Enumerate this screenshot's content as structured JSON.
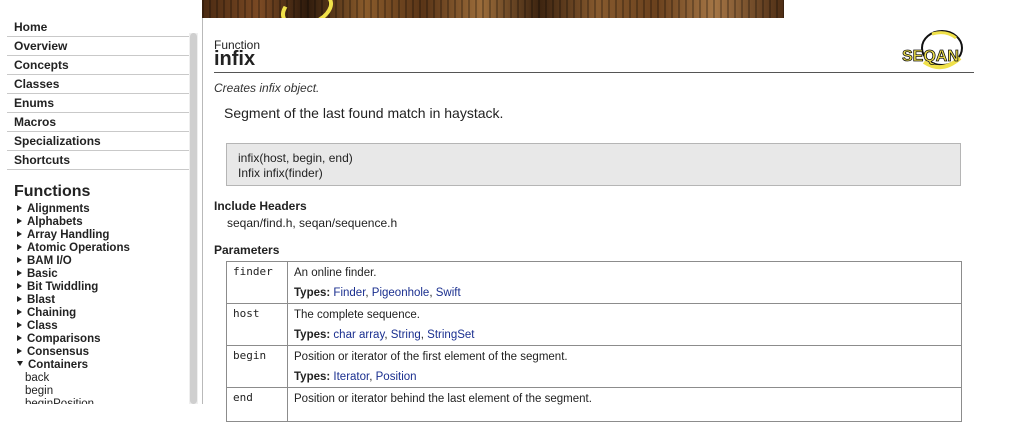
{
  "sidebar": {
    "nav": [
      "Home",
      "Overview",
      "Concepts",
      "Classes",
      "Enums",
      "Macros",
      "Specializations",
      "Shortcuts"
    ],
    "heading": "Functions",
    "categories": [
      "Alignments",
      "Alphabets",
      "Array Handling",
      "Atomic Operations",
      "BAM I/O",
      "Basic",
      "Bit Twiddling",
      "Blast",
      "Chaining",
      "Class",
      "Comparisons",
      "Consensus"
    ],
    "expanded_category": "Containers",
    "subitems": [
      "back",
      "begin",
      "beginPosition"
    ]
  },
  "page": {
    "kind": "Function",
    "title": "infix",
    "logo_text": "SEQAN",
    "summary": "Creates infix object.",
    "description": "Segment of the last found match in haystack.",
    "signature": [
      "infix(host, begin, end)",
      "Infix infix(finder)"
    ],
    "include_heading": "Include Headers",
    "include_value": "seqan/find.h, seqan/sequence.h",
    "params_heading": "Parameters"
  },
  "params": {
    "types_label": "Types:",
    "rows": [
      {
        "name": "finder",
        "desc": "An online finder.",
        "types": [
          "Finder",
          "Pigeonhole",
          "Swift"
        ]
      },
      {
        "name": "host",
        "desc": "The complete sequence.",
        "types": [
          "char array",
          "String",
          "StringSet"
        ]
      },
      {
        "name": "begin",
        "desc": "Position or iterator of the first element of the segment.",
        "types": [
          "Iterator",
          "Position"
        ]
      },
      {
        "name": "end",
        "desc": "Position or iterator behind the last element of the segment."
      }
    ]
  },
  "colors": {
    "link": "#1a2f8f",
    "logo_yellow": "#f0e14a",
    "signature_bg": "#e8e8e8"
  }
}
